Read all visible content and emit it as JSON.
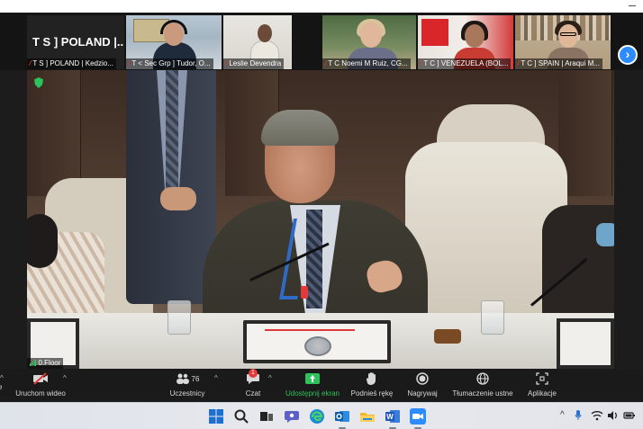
{
  "thumbnails": [
    {
      "name_card": "T S ] POLAND |...",
      "label": "T S ] POLAND | Kedzio...",
      "scene": "namecard"
    },
    {
      "label": "T < Sec Grp ] Tudor, O...",
      "scene": "map"
    },
    {
      "label": "Leslie Devendra",
      "scene": "grey"
    },
    {
      "label": "T C  Noemi M Ruiz, CG...",
      "scene": "plant"
    },
    {
      "label": "T C ] VENEZUELA (BOL...",
      "scene": "red"
    },
    {
      "label": "T C ] SPAIN | Araqui M...",
      "scene": "shelf"
    }
  ],
  "main_video": {
    "label": "0.Floor",
    "security_icon": "shield-icon"
  },
  "toolbar": {
    "video": "Uruchom wideo",
    "participants": "Uczestnicy",
    "participants_count": "76",
    "chat": "Czat",
    "chat_badge": "1",
    "share": "Udostępnij ekran",
    "raise_hand": "Podnieś rękę",
    "record": "Nagrywaj",
    "interpretation": "Tłumaczenie ustne",
    "apps": "Aplikacje",
    "left_partial": "e"
  },
  "taskbar": {
    "icons": [
      "windows-start-icon",
      "search-icon",
      "task-view-icon",
      "chat-icon",
      "edge-icon",
      "outlook-icon",
      "file-explorer-icon",
      "word-icon",
      "zoom-icon"
    ],
    "tray": [
      "chevron-up-icon",
      "microphone-icon",
      "wifi-icon",
      "volume-icon",
      "battery-icon"
    ]
  },
  "colors": {
    "zoom_blue": "#2d8cff",
    "share_green": "#2ec25b",
    "muted_red": "#e0362c"
  }
}
